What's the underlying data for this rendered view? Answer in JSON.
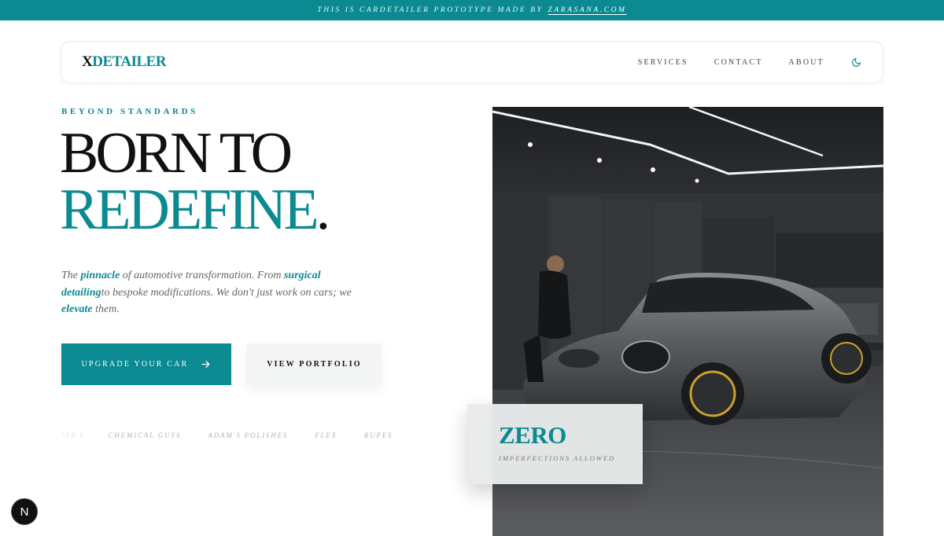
{
  "banner": {
    "text": "THIS IS CARDETAILER PROTOTYPE MADE BY",
    "link": "ZARASANA.COM"
  },
  "nav": {
    "logo_x": "X",
    "logo_rest": "DETAILER",
    "items": [
      "SERVICES",
      "CONTACT",
      "ABOUT"
    ],
    "theme_icon": "moon-icon"
  },
  "hero": {
    "eyebrow": "BEYOND STANDARDS",
    "title_line1": "BORN TO",
    "title_line2": "REDEFINE",
    "title_dot": ".",
    "lead": {
      "t1": "The ",
      "b1": "pinnacle",
      "t2": " of automotive transformation. From ",
      "b2": "surgical detailing",
      "t3": "to bespoke modifications. We don't just work on cars; we ",
      "b3": "elevate",
      "t4": " them."
    },
    "primary_button": "UPGRADE YOUR CAR",
    "primary_button_icon": "arrow-right-icon",
    "secondary_button": "VIEW PORTFOLIO",
    "brands": [
      "IAR'S",
      "CHEMICAL GUYS",
      "ADAM'S POLISHES",
      "FLEX",
      "RUPES"
    ]
  },
  "feature_card": {
    "headline": "ZERO",
    "caption": "IMPERFECTIONS ALLOWED"
  },
  "dev_badge": "N",
  "colors": {
    "accent": "#0b8a92",
    "text": "#111111",
    "muted": "#666666"
  }
}
